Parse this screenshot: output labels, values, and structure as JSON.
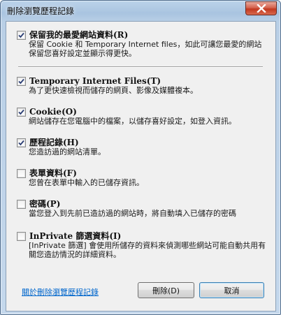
{
  "window": {
    "title": "刪除瀏覽歷程記錄"
  },
  "options": [
    {
      "label": "保留我的最愛網站資料(R)",
      "description": "保留 Cookie 和 Temporary Internet files，如此可讓您最愛的網站保留您喜好設定並顯示得更快。",
      "checked": true
    },
    {
      "label": "Temporary Internet Files(T)",
      "description": "為了更快速檢視而儲存的網頁、影像及媒體複本。",
      "checked": true
    },
    {
      "label": "Cookie(O)",
      "description": "網站儲存在您電腦中的檔案，以儲存喜好設定，如登入資訊。",
      "checked": true
    },
    {
      "label": "歷程記錄(H)",
      "description": "您造訪過的網站清單。",
      "checked": true
    },
    {
      "label": "表單資料(F)",
      "description": "您曾在表單中輸入的已儲存資訊。",
      "checked": false
    },
    {
      "label": "密碼(P)",
      "description": "當您登入到先前已造訪過的網站時，將自動填入已儲存的密碼",
      "checked": false
    },
    {
      "label": "InPrivate 篩選資料(I)",
      "description": "[InPrivate 篩選] 會使用所儲存的資料來偵測哪些網站可能自動共用有關您造訪情況的詳細資料。",
      "checked": false
    }
  ],
  "footer": {
    "link_text": "關於刪除瀏覽歷程記錄",
    "delete_label": "刪除(D)",
    "cancel_label": "取消"
  }
}
